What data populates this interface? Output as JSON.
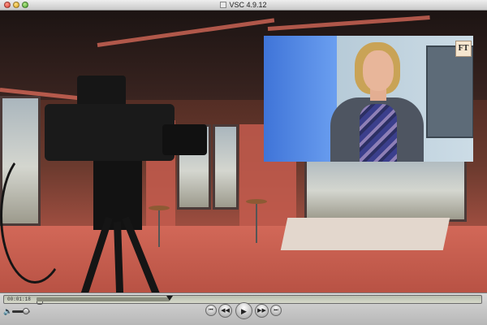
{
  "window": {
    "title": "VSC 4.9.12"
  },
  "video": {
    "inset": {
      "logo_text": "FT"
    }
  },
  "controller": {
    "time": "00:01:18",
    "progress": 0.3,
    "volume": 0.75,
    "icons": {
      "volume": "speaker-icon",
      "go_start": "skip-back-icon",
      "rewind": "rewind-icon",
      "play": "play-icon",
      "fast_forward": "fast-forward-icon",
      "go_end": "skip-forward-icon"
    },
    "glyphs": {
      "volume": "🔈",
      "go_start": "⏮",
      "rewind": "◀◀",
      "play": "▶",
      "fast_forward": "▶▶",
      "go_end": "⏭"
    }
  },
  "colors": {
    "studio_glow": "#d26858",
    "inset_blue": "#3f74d8"
  }
}
